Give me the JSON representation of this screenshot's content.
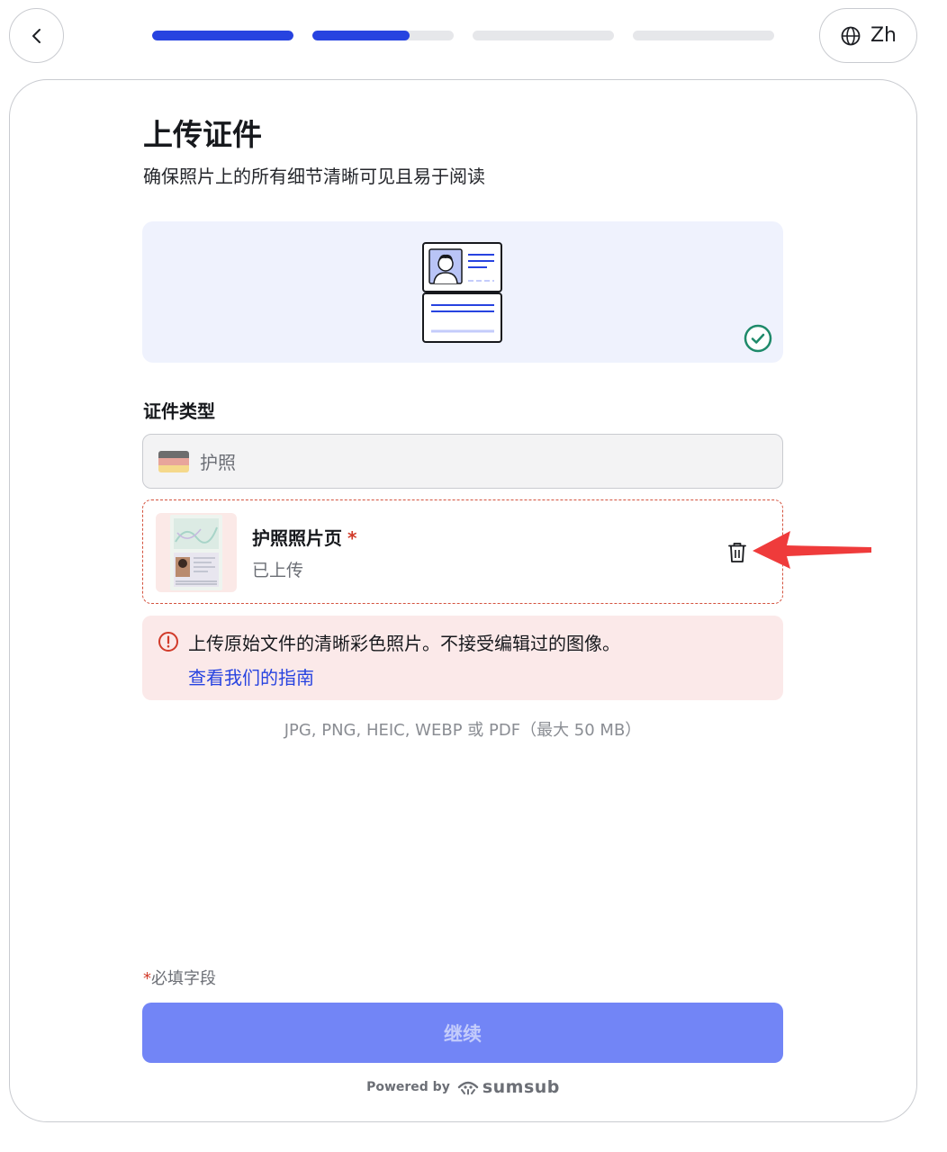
{
  "header": {
    "back_icon": "chevron-left-icon",
    "progress": [
      1.0,
      0.69,
      0.0,
      0.0
    ],
    "language_label": "Zh",
    "language_icon": "globe-icon"
  },
  "page": {
    "title": "上传证件",
    "subtitle": "确保照片上的所有细节清晰可见且易于阅读"
  },
  "illustration": {
    "icon": "id-card-illustration",
    "status_icon": "check-circle-icon"
  },
  "document_type": {
    "label": "证件类型",
    "selected_value": "护照",
    "flag_colors": [
      "#6d6d6d",
      "#e8a59b",
      "#f5d98b"
    ]
  },
  "upload_item": {
    "title": "护照照片页",
    "required_mark": "*",
    "status": "已上传",
    "delete_icon": "trash-icon"
  },
  "error": {
    "icon": "alert-circle-icon",
    "message": "上传原始文件的清晰彩色照片。不接受编辑过的图像。",
    "link": "查看我们的指南"
  },
  "formats": "JPG, PNG, HEIC, WEBP 或 PDF（最大 50 MB）",
  "footer": {
    "required_star": "*",
    "required_note": "必填字段",
    "continue_label": "继续",
    "powered_by": "Powered by",
    "brand": "sumsub"
  },
  "colors": {
    "accent": "#2743e0",
    "button_bg": "#7285f6",
    "error_bg": "#fbe9e9",
    "success": "#1e8a6a",
    "annotation_arrow": "#ef3b3b"
  }
}
